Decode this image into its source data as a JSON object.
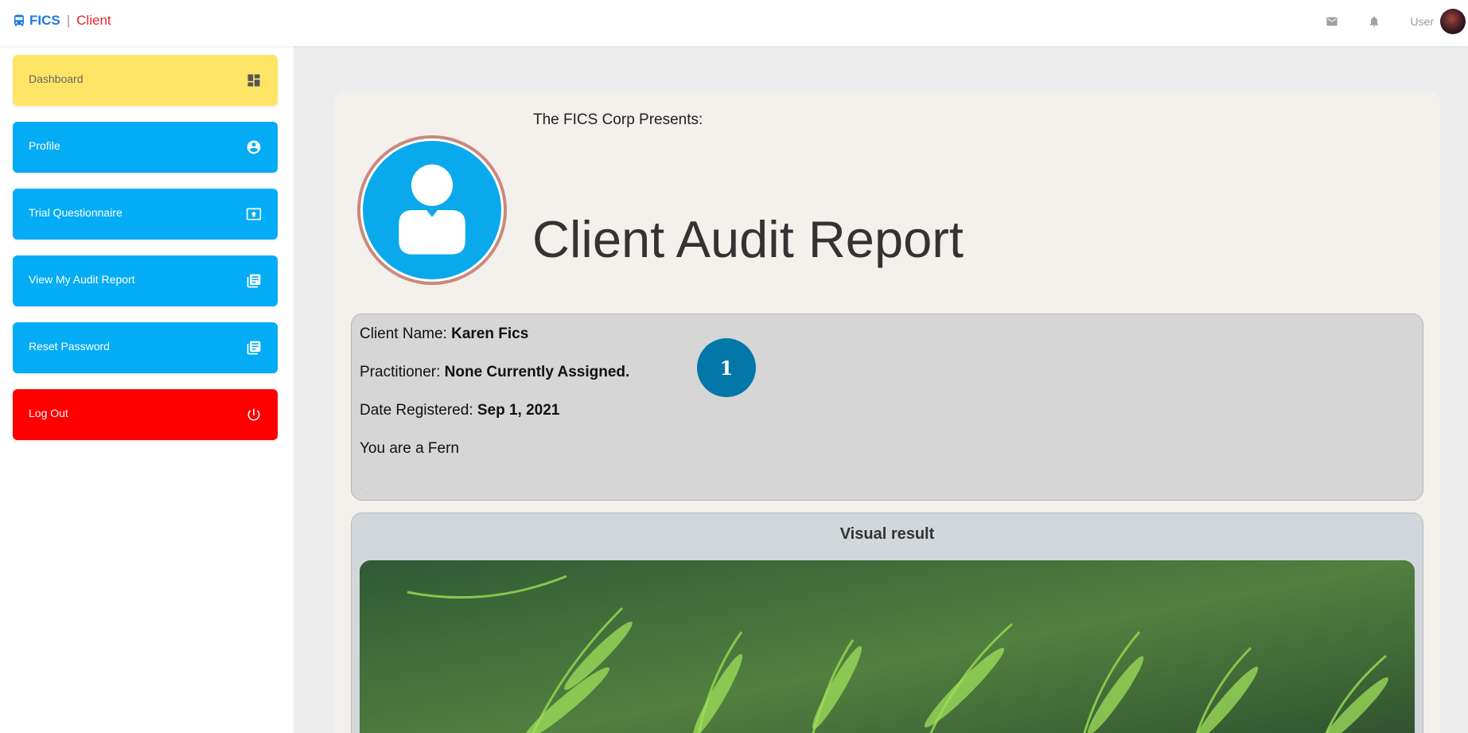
{
  "brand": {
    "name": "FICS",
    "separator": "|",
    "section": "Client"
  },
  "topbar": {
    "user_label": "User",
    "icons": [
      "mail-icon",
      "bell-icon"
    ]
  },
  "sidebar": {
    "items": [
      {
        "label": "Dashboard",
        "icon": "dashboard-icon",
        "color": "#ffe566"
      },
      {
        "label": "Profile",
        "icon": "account-circle-icon",
        "color": "#04acf5"
      },
      {
        "label": "Trial Questionnaire",
        "icon": "upload-screen-icon",
        "color": "#04acf5"
      },
      {
        "label": "View My Audit Report",
        "icon": "library-books-icon",
        "color": "#04acf5"
      },
      {
        "label": "Reset Password",
        "icon": "library-books-icon",
        "color": "#04acf5"
      },
      {
        "label": "Log Out",
        "icon": "power-icon",
        "color": "#ff0000"
      }
    ]
  },
  "report": {
    "presents": "The FICS Corp Presents:",
    "title": "Client Audit Report",
    "client_name_label": "Client Name:",
    "client_name": "Karen Fics",
    "practitioner_label": "Practitioner:",
    "practitioner": "None Currently Assigned.",
    "date_label": "Date Registered:",
    "date": "Sep 1, 2021",
    "type_line": "You are a Fern",
    "badge": "1",
    "footnote": "."
  },
  "visual": {
    "title": "Visual result",
    "image": "fern-photo"
  },
  "colors": {
    "accent_blue": "#04acf5",
    "dashboard_yellow": "#ffe566",
    "logout_red": "#ff0000",
    "badge_blue": "#0378a8"
  }
}
